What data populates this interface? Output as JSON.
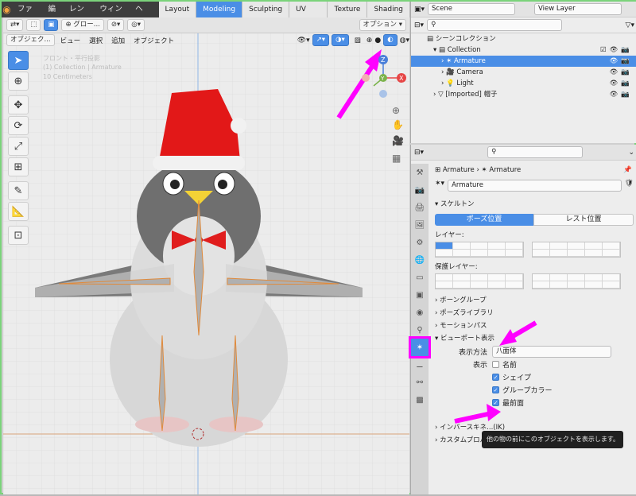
{
  "menu": {
    "items": [
      "ファイル",
      "編集",
      "レンダー",
      "ウィンドウ",
      "ヘルプ"
    ]
  },
  "workspaces": {
    "tabs": [
      "Layout",
      "Modeling",
      "Sculpting",
      "UV Editing",
      "Texture Paint",
      "Shading"
    ],
    "active": "Modeling"
  },
  "viewport": {
    "header": {
      "mode": "オブジェク...",
      "view": "ビュー",
      "select": "選択",
      "add": "追加",
      "object": "オブジェクト",
      "transform": "グロー...",
      "options": "オプション"
    },
    "overlay_text": [
      "フロント・平行投影",
      "(1) Collection | Armature",
      "10 Centimeters"
    ],
    "gizmo": {
      "z": "Z",
      "y": "Y",
      "x": "X"
    }
  },
  "outliner": {
    "scene": "Scene",
    "view_layer": "View Layer",
    "rows": [
      {
        "label": "シーンコレクション",
        "depth": 0
      },
      {
        "label": "Collection",
        "depth": 1
      },
      {
        "label": "Armature",
        "depth": 2,
        "selected": true
      },
      {
        "label": "Camera",
        "depth": 2
      },
      {
        "label": "Light",
        "depth": 2
      },
      {
        "label": "[Imported] 帽子",
        "depth": 1
      }
    ]
  },
  "properties": {
    "breadcrumb": {
      "obj": "Armature",
      "sep": "›",
      "data": "Armature"
    },
    "data_name": "Armature",
    "skeleton": "スケルトン",
    "pose_position": "ポーズ位置",
    "rest_position": "レスト位置",
    "layer_label": "レイヤー:",
    "protected_label": "保護レイヤー:",
    "sections": [
      "ボーングループ",
      "ポーズライブラリ",
      "モーションパス",
      "ビューポート表示"
    ],
    "display_method_label": "表示方法",
    "display_method": "八面体",
    "show_label": "表示",
    "checks": [
      {
        "label": "名前",
        "on": false
      },
      {
        "label": "シェイプ",
        "on": true
      },
      {
        "label": "グループカラー",
        "on": true
      },
      {
        "label": "最前面",
        "on": true
      }
    ],
    "after_sections": [
      "インバースキネ...(IK)",
      "カスタムプロパティ"
    ]
  },
  "tooltip": "他の物の前にこのオブジェクトを表示します。",
  "accent": "#4a8ee6",
  "annotation": "#ff00ff"
}
